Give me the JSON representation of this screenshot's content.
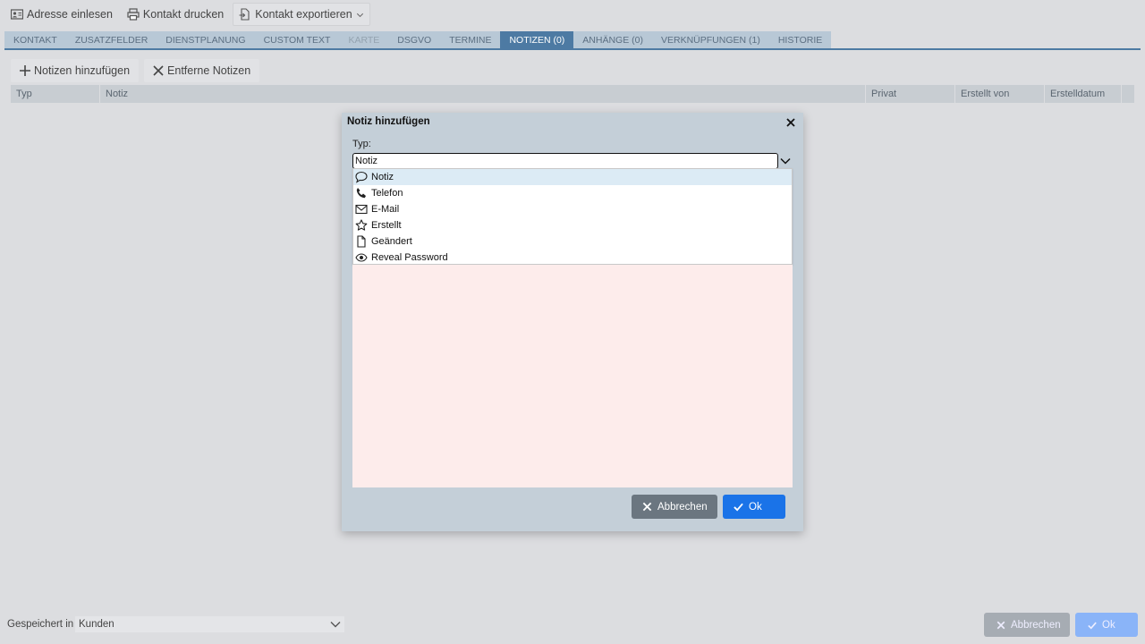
{
  "toolbar": {
    "read_address": "Adresse einlesen",
    "print_contact": "Kontakt drucken",
    "export_contact": "Kontakt exportieren"
  },
  "tabs": [
    {
      "label": "KONTAKT",
      "state": "normal"
    },
    {
      "label": "ZUSATZFELDER",
      "state": "normal"
    },
    {
      "label": "DIENSTPLANUNG",
      "state": "normal"
    },
    {
      "label": "CUSTOM TEXT",
      "state": "normal"
    },
    {
      "label": "KARTE",
      "state": "disabled"
    },
    {
      "label": "DSGVO",
      "state": "normal"
    },
    {
      "label": "TERMINE",
      "state": "normal"
    },
    {
      "label": "NOTIZEN (0)",
      "state": "active"
    },
    {
      "label": "ANHÄNGE (0)",
      "state": "normal"
    },
    {
      "label": "VERKNÜPFUNGEN (1)",
      "state": "normal"
    },
    {
      "label": "HISTORIE",
      "state": "normal"
    }
  ],
  "notes_toolbar": {
    "add_label": "Notizen hinzufügen",
    "remove_label": "Entferne Notizen"
  },
  "grid": {
    "columns": [
      "Typ",
      "Notiz",
      "Privat",
      "Erstellt von",
      "Erstelldatum"
    ]
  },
  "dialog": {
    "title": "Notiz hinzufügen",
    "type_label": "Typ:",
    "type_value": "Notiz",
    "options": [
      {
        "label": "Notiz",
        "icon": "speech-bubble-icon",
        "selected": true
      },
      {
        "label": "Telefon",
        "icon": "phone-icon",
        "selected": false
      },
      {
        "label": "E-Mail",
        "icon": "envelope-icon",
        "selected": false
      },
      {
        "label": "Erstellt",
        "icon": "star-icon",
        "selected": false
      },
      {
        "label": "Geändert",
        "icon": "document-icon",
        "selected": false
      },
      {
        "label": "Reveal Password",
        "icon": "eye-icon",
        "selected": false
      }
    ],
    "cancel_label": "Abbrechen",
    "ok_label": "Ok"
  },
  "footer": {
    "saved_in_label": "Gespeichert in",
    "saved_in_value": "Kunden",
    "cancel_label": "Abbrechen",
    "ok_label": "Ok"
  },
  "colors": {
    "active_tab": "#4d7aa3",
    "ok_button": "#1a73e8",
    "note_area": "#fdeceb"
  }
}
